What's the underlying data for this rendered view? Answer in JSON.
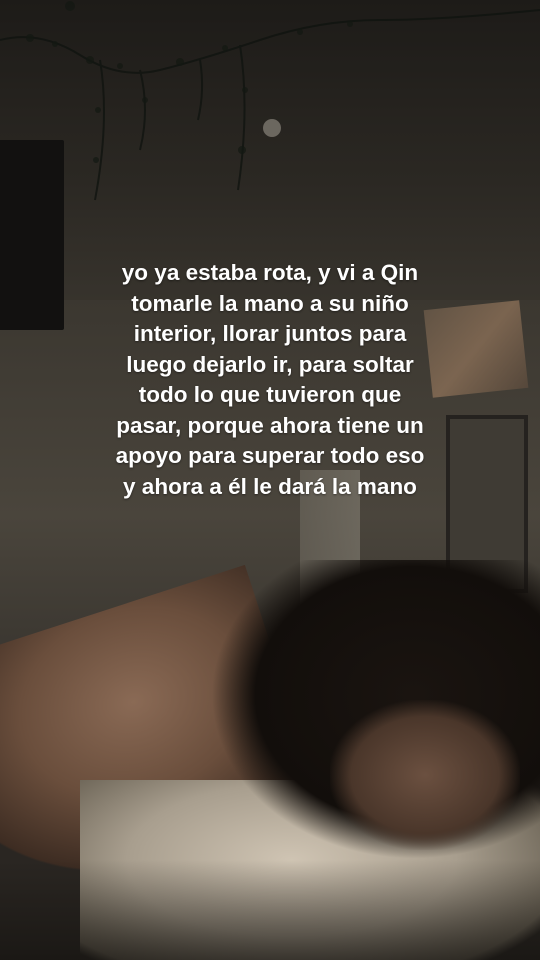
{
  "caption": {
    "lines": [
      "yo ya estaba rota, y vi a Qin",
      "tomarle la mano a su niño",
      "interior, llorar juntos para",
      "luego dejarlo ir, para soltar",
      "todo lo que tuvieron que",
      "pasar, porque ahora tiene un",
      "apoyo para superar todo eso",
      "y ahora a él le dará la mano"
    ],
    "color": "#ffffff"
  }
}
